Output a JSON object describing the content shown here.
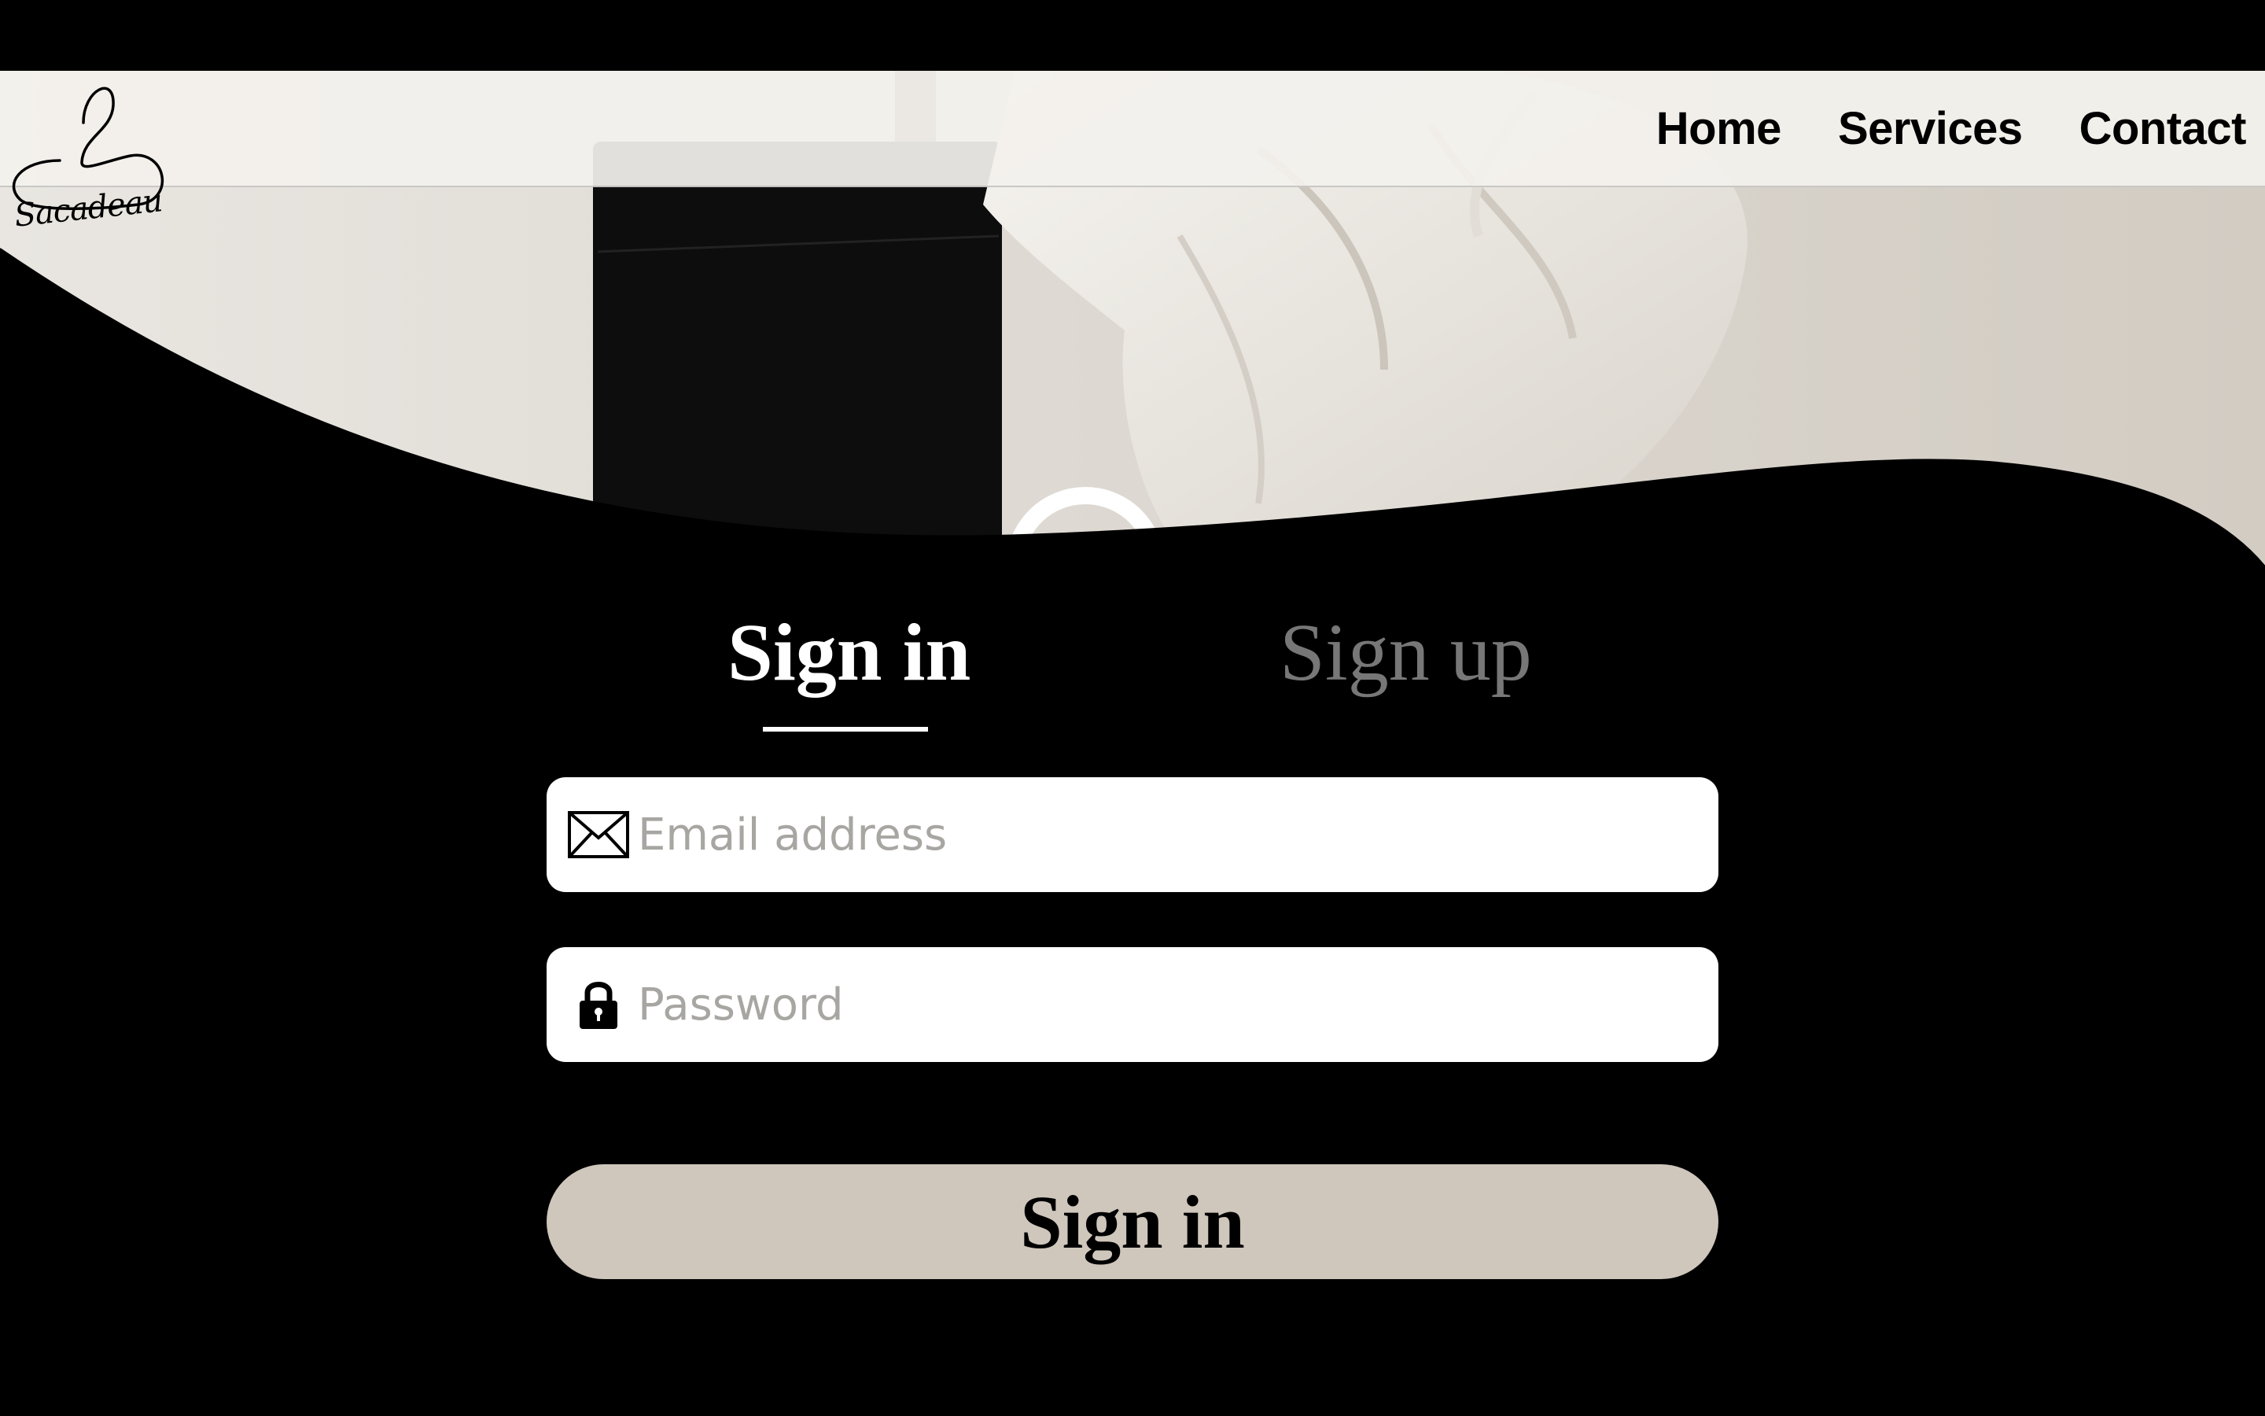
{
  "brand": {
    "name": "Sacadeau",
    "logo_icon": "hanger-logo-icon"
  },
  "nav": {
    "items": [
      {
        "label": "Home"
      },
      {
        "label": "Services"
      },
      {
        "label": "Contact"
      }
    ]
  },
  "auth": {
    "tabs": [
      {
        "label": "Sign in",
        "active": true
      },
      {
        "label": "Sign up",
        "active": false
      }
    ],
    "email": {
      "placeholder": "Email address",
      "value": "",
      "icon": "envelope-icon"
    },
    "password": {
      "placeholder": "Password",
      "value": "",
      "icon": "lock-icon"
    },
    "submit_label": "Sign in"
  },
  "colors": {
    "background": "#000000",
    "button": "#cfc6bc",
    "active_tab": "#ffffff",
    "inactive_tab": "#777777",
    "placeholder": "#a8a6a2"
  }
}
